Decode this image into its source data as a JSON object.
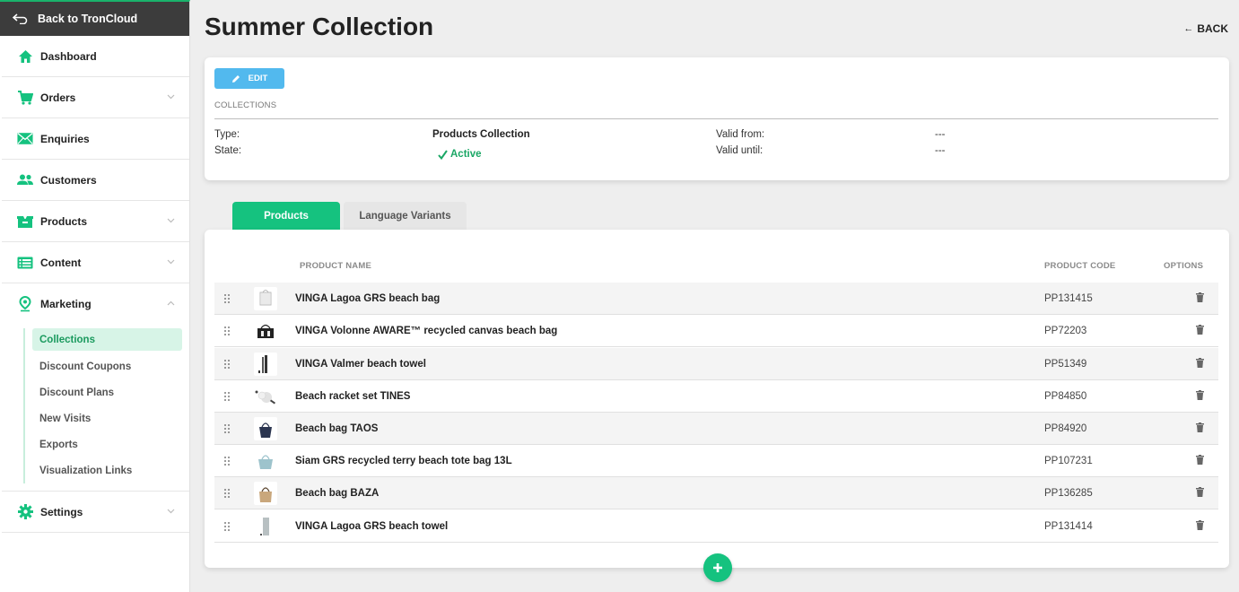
{
  "sidebar": {
    "back_label": "Back to TronCloud",
    "items": [
      {
        "label": "Dashboard",
        "icon": "home-icon"
      },
      {
        "label": "Orders",
        "icon": "cart-icon"
      },
      {
        "label": "Enquiries",
        "icon": "envelope-icon"
      },
      {
        "label": "Customers",
        "icon": "users-icon"
      },
      {
        "label": "Products",
        "icon": "box-icon"
      },
      {
        "label": "Content",
        "icon": "list-icon"
      },
      {
        "label": "Marketing",
        "icon": "location-pin-icon"
      },
      {
        "label": "Settings",
        "icon": "gear-icon"
      }
    ],
    "marketing_sub": [
      "Collections",
      "Discount Coupons",
      "Discount Plans",
      "New Visits",
      "Exports",
      "Visualization Links"
    ]
  },
  "header": {
    "title": "Summer Collection",
    "back_label": "BACK"
  },
  "info": {
    "edit_label": "EDIT",
    "section_label": "COLLECTIONS",
    "type_label": "Type:",
    "type_value": "Products Collection",
    "state_label": "State:",
    "state_value": "Active",
    "valid_from_label": "Valid from:",
    "valid_from_value": "---",
    "valid_until_label": "Valid until:",
    "valid_until_value": "---"
  },
  "tabs": [
    "Products",
    "Language Variants"
  ],
  "table": {
    "headers": {
      "name": "PRODUCT NAME",
      "code": "PRODUCT CODE",
      "options": "OPTIONS"
    },
    "rows": [
      {
        "name": "VINGA Lagoa GRS beach bag",
        "code": "PP131415"
      },
      {
        "name": "VINGA Volonne AWARE™ recycled canvas beach bag",
        "code": "PP72203"
      },
      {
        "name": "VINGA Valmer beach towel",
        "code": "PP51349"
      },
      {
        "name": "Beach racket set TINES",
        "code": "PP84850"
      },
      {
        "name": "Beach bag TAOS",
        "code": "PP84920"
      },
      {
        "name": "Siam GRS recycled terry beach tote bag 13L",
        "code": "PP107231"
      },
      {
        "name": "Beach bag BAZA",
        "code": "PP136285"
      },
      {
        "name": "VINGA Lagoa GRS beach towel",
        "code": "PP131414"
      }
    ]
  },
  "colors": {
    "accent": "#15c27f",
    "edit": "#52b9ee",
    "active": "#1aa765"
  }
}
